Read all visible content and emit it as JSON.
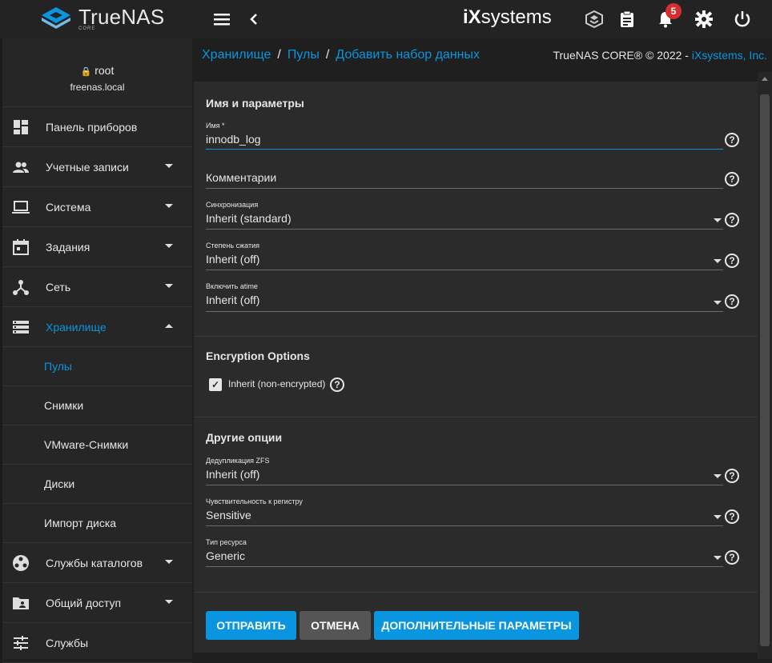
{
  "topbar": {
    "logo_text": "TrueNAS",
    "logo_sub": "CORE",
    "ix_brand_i": "iX",
    "ix_brand_rest": "systems",
    "notification_count": "5",
    "icons": [
      "menu-icon",
      "chevron-left-icon",
      "truecommand-icon",
      "task-manager-icon",
      "bell-icon",
      "gear-icon",
      "power-icon"
    ]
  },
  "sidebar": {
    "user": "root",
    "host": "freenas.local",
    "items": [
      {
        "label": "Панель приборов",
        "icon": "dashboard-icon",
        "caret": false
      },
      {
        "label": "Учетные записи",
        "icon": "people-icon",
        "caret": true
      },
      {
        "label": "Система",
        "icon": "laptop-icon",
        "caret": true
      },
      {
        "label": "Задания",
        "icon": "calendar-icon",
        "caret": true
      },
      {
        "label": "Сеть",
        "icon": "network-icon",
        "caret": true
      },
      {
        "label": "Хранилище",
        "icon": "storage-icon",
        "caret": true,
        "expanded": true
      }
    ],
    "sub_items": [
      "Пулы",
      "Снимки",
      "VMware-Снимки",
      "Диски",
      "Импорт диска"
    ],
    "items_after": [
      {
        "label": "Службы каталогов",
        "icon": "directory-icon",
        "caret": true
      },
      {
        "label": "Общий доступ",
        "icon": "shared-folder-icon",
        "caret": true
      },
      {
        "label": "Службы",
        "icon": "tune-icon",
        "caret": false
      }
    ]
  },
  "breadcrumb": {
    "items": [
      "Хранилище",
      "Пулы",
      "Добавить набор данных"
    ],
    "separator": "/"
  },
  "copyright": {
    "text": "TrueNAS CORE® © 2022 - ",
    "link": "iXsystems, Inc."
  },
  "form": {
    "section1_title": "Имя и параметры",
    "name_label": "Имя *",
    "name_value": "innodb_log",
    "comment_placeholder": "Комментарии",
    "sync_label": "Синхронизация",
    "sync_value": "Inherit (standard)",
    "compression_label": "Степень сжатия",
    "compression_value": "Inherit (off)",
    "atime_label": "Включить atime",
    "atime_value": "Inherit (off)",
    "section2_title": "Encryption Options",
    "encryption_checkbox_label": "Inherit (non-encrypted)",
    "encryption_checked": true,
    "section3_title": "Другие опции",
    "dedup_label": "Дедупликация ZFS",
    "dedup_value": "Inherit (off)",
    "case_label": "Чувствительность к регистру",
    "case_value": "Sensitive",
    "share_label": "Тип ресурса",
    "share_value": "Generic",
    "help_glyph": "?",
    "check_glyph": "✓"
  },
  "buttons": {
    "submit": "ОТПРАВИТЬ",
    "cancel": "ОТМЕНА",
    "advanced": "ДОПОЛНИТЕЛЬНЫЕ ПАРАМЕТРЫ"
  },
  "colors": {
    "accent": "#0a95e0",
    "cancel": "#555555",
    "badge": "#d32f2f"
  }
}
